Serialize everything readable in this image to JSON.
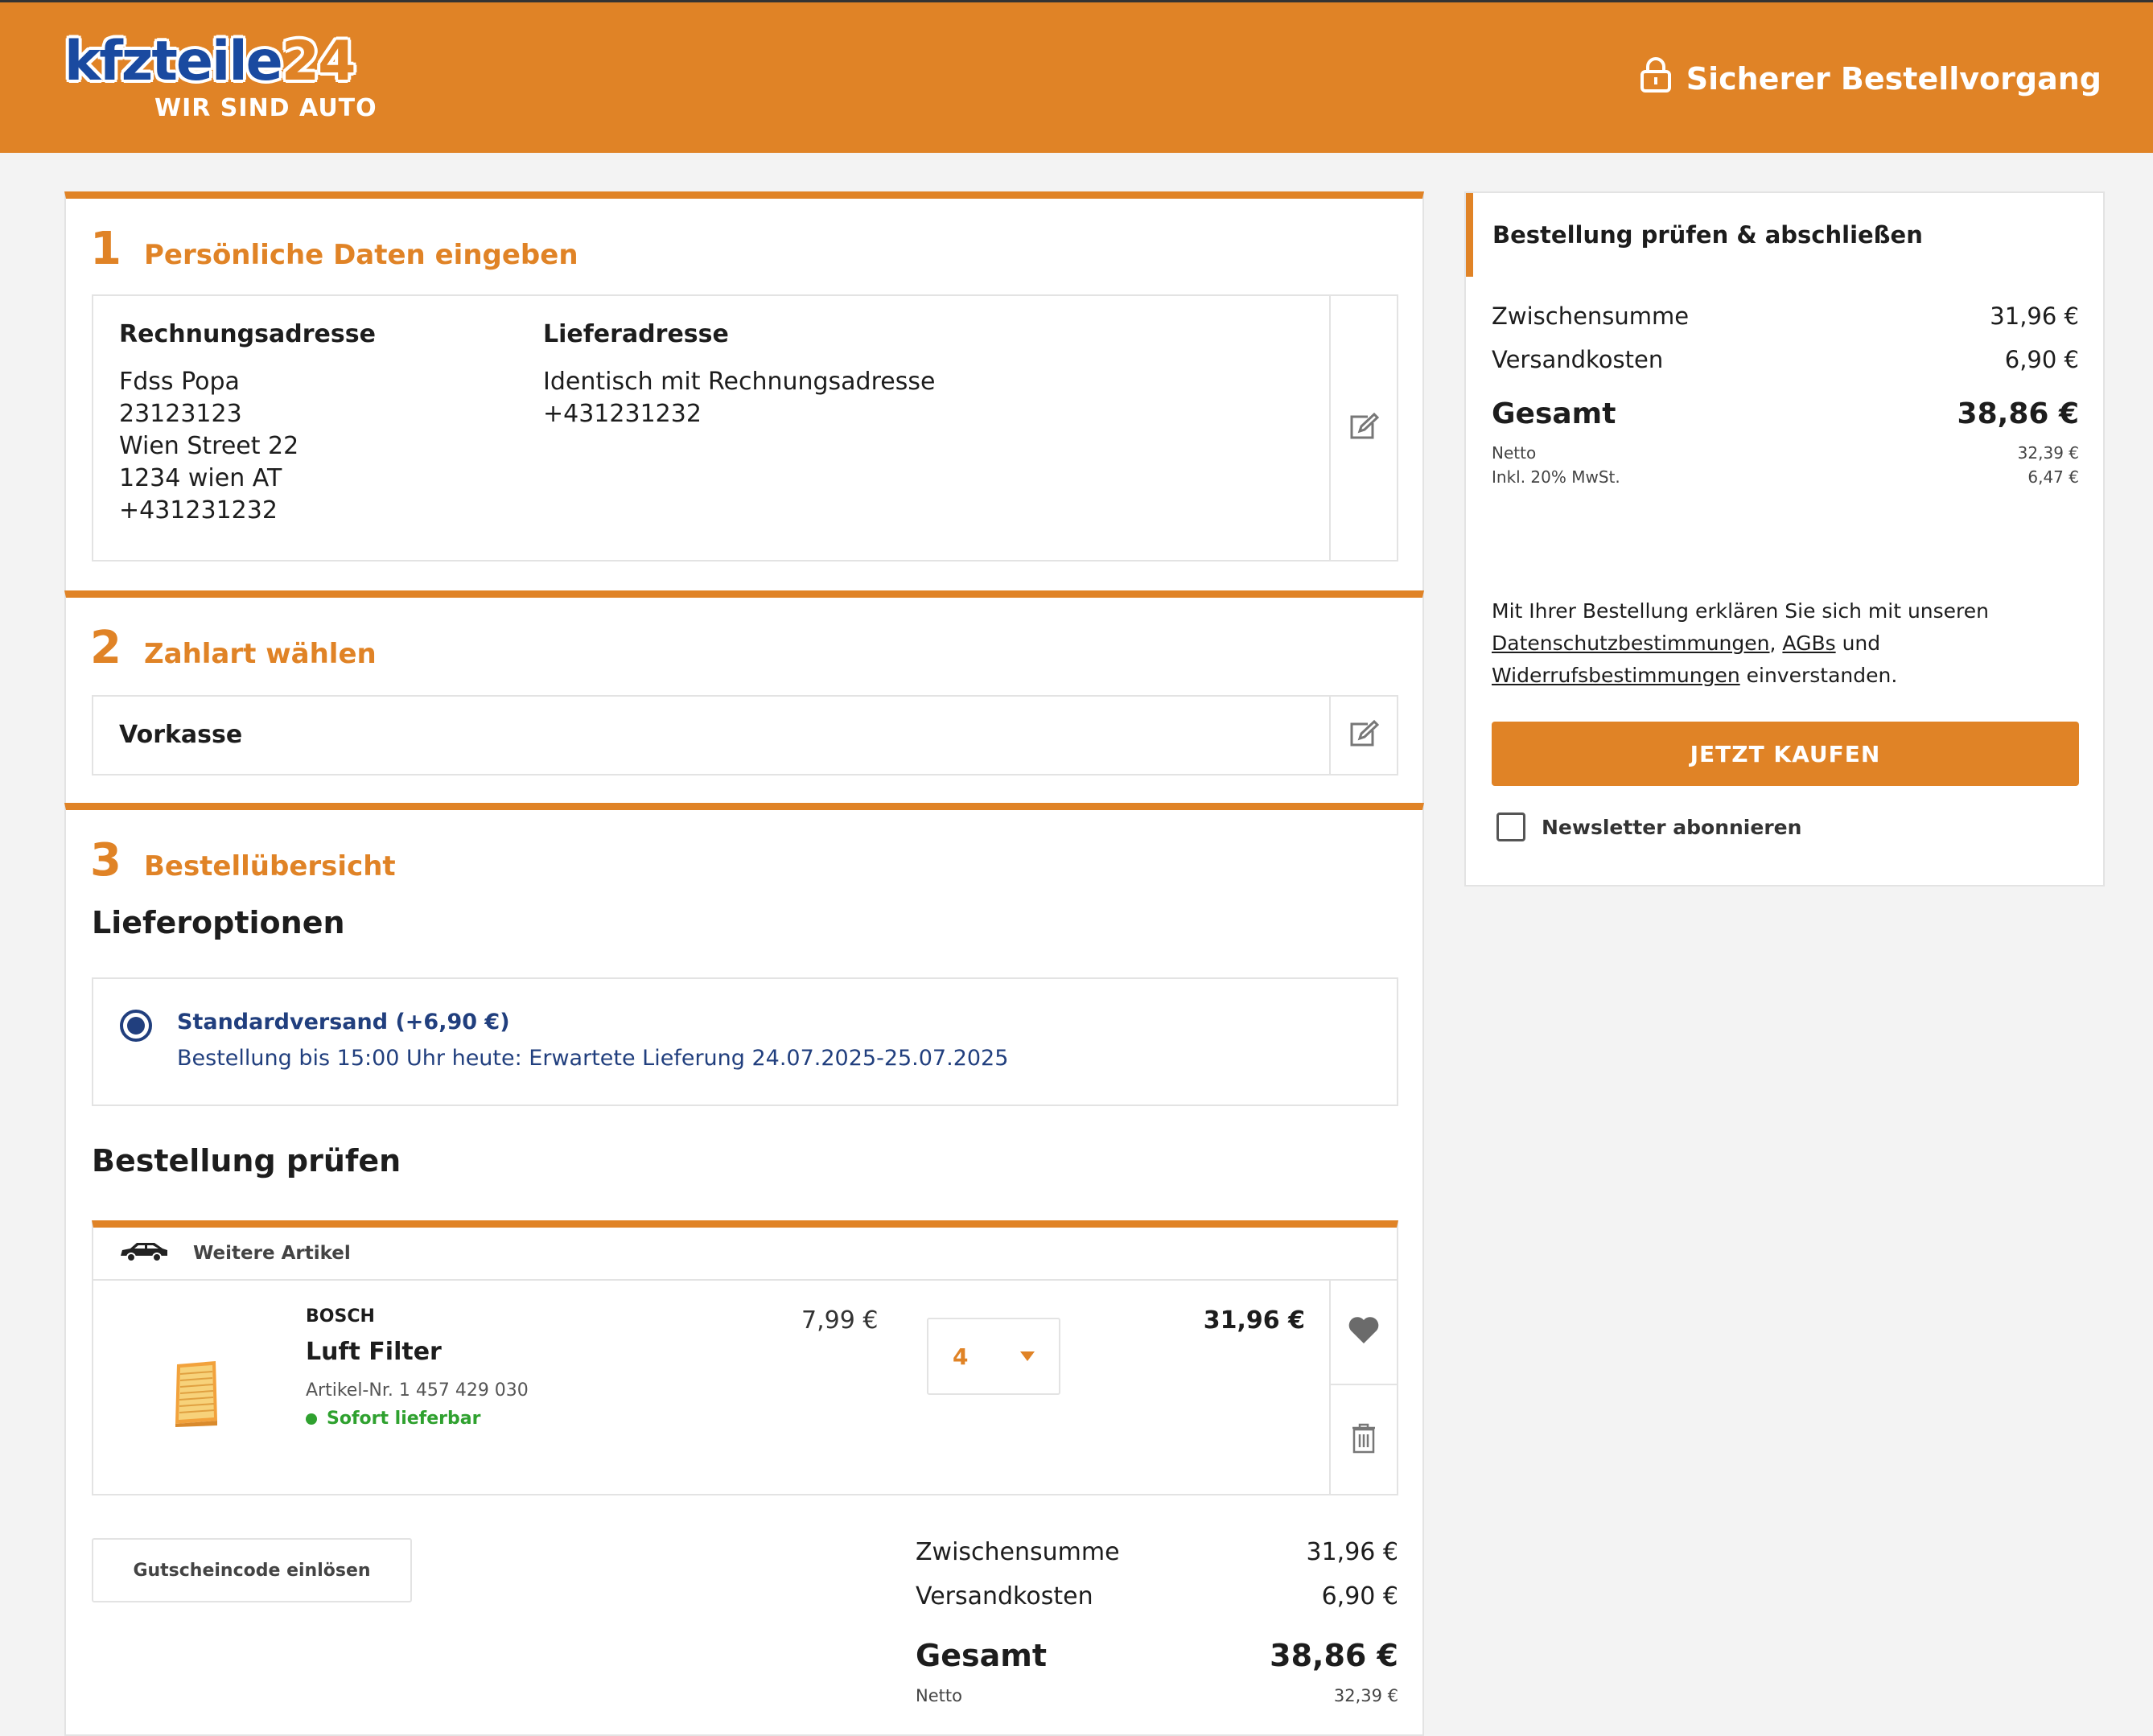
{
  "header": {
    "logo_text": "kfzteile",
    "logo_number": "24",
    "logo_tagline": "WIR SIND AUTO",
    "secure_text": "Sicherer Bestellvorgang"
  },
  "step1": {
    "number": "1",
    "title": "Persönliche Daten eingeben",
    "billing_label": "Rechnungsadresse",
    "billing_lines": [
      "Fdss Popa",
      "23123123",
      "Wien Street 22",
      "1234 wien AT",
      "+431231232"
    ],
    "shipping_label": "Lieferadresse",
    "shipping_lines": [
      "Identisch mit Rechnungsadresse",
      "+431231232"
    ]
  },
  "step2": {
    "number": "2",
    "title": "Zahlart wählen",
    "payment_method": "Vorkasse"
  },
  "step3": {
    "number": "3",
    "title": "Bestellübersicht",
    "delivery_heading": "Lieferoptionen",
    "delivery_option": "Standardversand (+6,90 €)",
    "delivery_note": "Bestellung bis 15:00 Uhr heute: Erwartete Lieferung 24.07.2025-25.07.2025",
    "review_heading": "Bestellung prüfen",
    "group_label": "Weitere Artikel",
    "item": {
      "brand": "BOSCH",
      "name": "Luft Filter",
      "article_no": "Artikel-Nr. 1 457 429 030",
      "availability": "Sofort lieferbar",
      "unit_price": "7,99 €",
      "quantity": "4",
      "total": "31,96 €"
    },
    "coupon_button": "Gutscheincode einlösen",
    "summary": {
      "subtotal_label": "Zwischensumme",
      "subtotal": "31,96 €",
      "shipping_label": "Versandkosten",
      "shipping": "6,90 €",
      "total_label": "Gesamt",
      "total": "38,86 €",
      "net_label": "Netto",
      "net": "32,39 €"
    }
  },
  "sidebar": {
    "title": "Bestellung prüfen & abschließen",
    "subtotal_label": "Zwischensumme",
    "subtotal": "31,96 €",
    "shipping_label": "Versandkosten",
    "shipping": "6,90 €",
    "total_label": "Gesamt",
    "total": "38,86 €",
    "net_label": "Netto",
    "net": "32,39 €",
    "vat_label": "Inkl. 20% MwSt.",
    "vat": "6,47 €",
    "legal_prefix": "Mit Ihrer Bestellung erklären Sie sich mit unseren",
    "link_privacy": "Datenschutzbestimmungen",
    "comma": ",",
    "link_terms": "AGBs",
    "and": "und",
    "link_withdrawal": "Widerrufsbestimmungen",
    "legal_suffix": "einverstanden.",
    "buy_button": "JETZT KAUFEN",
    "newsletter_label": "Newsletter abonnieren"
  },
  "colors": {
    "accent": "#e08326",
    "brand_blue": "#1a4aa0",
    "delivery_blue": "#213f7e",
    "available_green": "#2fa12f"
  }
}
